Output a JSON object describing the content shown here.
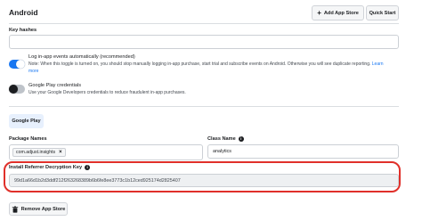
{
  "section_title": "Android",
  "buttons": {
    "add_app_store": "Add App Store",
    "quick_start": "Quick Start",
    "remove_app_store": "Remove App Store"
  },
  "key_hashes": {
    "label": "Key hashes",
    "value": ""
  },
  "log_events": {
    "title": "Log in-app events automatically (recommended)",
    "note": "Note: When this toggle is turned on, you should stop manually logging in-app purchase, start trial and subscribe events on Android. Otherwise you will see duplicate reporting.",
    "link": "Learn",
    "link2": "more",
    "enabled": true
  },
  "play_credentials": {
    "title": "Google Play credentials",
    "desc": "Use your Google Developers credentials to reduce fraudulent in-app purchases.",
    "enabled": false
  },
  "tab": "Google Play",
  "package_names": {
    "label": "Package Names",
    "chip": "com.adjust.insights"
  },
  "class_name": {
    "label": "Class Name",
    "value": "analytics"
  },
  "install_referrer": {
    "label": "Install Referrer Decryption Key",
    "value": "99d1a66d1b2d3ddf212f263268389b6b6fe8ee3773c1b12ced925174d2825407"
  },
  "colors": {
    "accent": "#1877f2",
    "highlight": "#e0302a"
  },
  "icons": [
    "plus-icon",
    "info-icon",
    "close-icon",
    "trash-icon"
  ]
}
